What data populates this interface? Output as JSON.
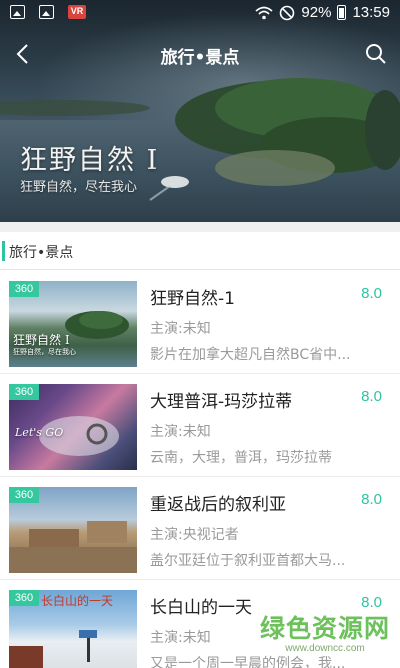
{
  "status_bar": {
    "left_icons": [
      "gallery-icon",
      "image-icon",
      "vr-icon"
    ],
    "vr_label": "VR",
    "battery": "92%",
    "time": "13:59"
  },
  "header": {
    "title": "旅行•景点",
    "hero_title": "狂野自然 I",
    "hero_subtitle": "狂野自然，尽在我心"
  },
  "section": {
    "title": "旅行•景点"
  },
  "items": [
    {
      "badge": "360",
      "title": "狂野自然-1",
      "score": "8.0",
      "cast": "主演:未知",
      "desc": "影片在加拿大超凡自然BC省中...",
      "thumb_caption": "狂野自然 I",
      "thumb_sub": "狂野自然，尽在我心"
    },
    {
      "badge": "360",
      "title": "大理普洱-玛莎拉蒂",
      "score": "8.0",
      "cast": "主演:未知",
      "desc": "云南，大理，普洱，玛莎拉蒂",
      "thumb_caption": "Let's GO",
      "thumb_sub": ""
    },
    {
      "badge": "360",
      "title": "重返战后的叙利亚",
      "score": "8.0",
      "cast": "主演:央视记者",
      "desc": "盖尔亚廷位于叙利亚首都大马...",
      "thumb_caption": "",
      "thumb_sub": ""
    },
    {
      "badge": "360",
      "title": "长白山的一天",
      "score": "8.0",
      "cast": "主演:未知",
      "desc": "又是一个周一早晨的例会，我...",
      "thumb_caption": "长白山的一天",
      "thumb_sub": ""
    }
  ],
  "watermark": {
    "main": "绿色资源网",
    "url": "www.downcc.com"
  }
}
